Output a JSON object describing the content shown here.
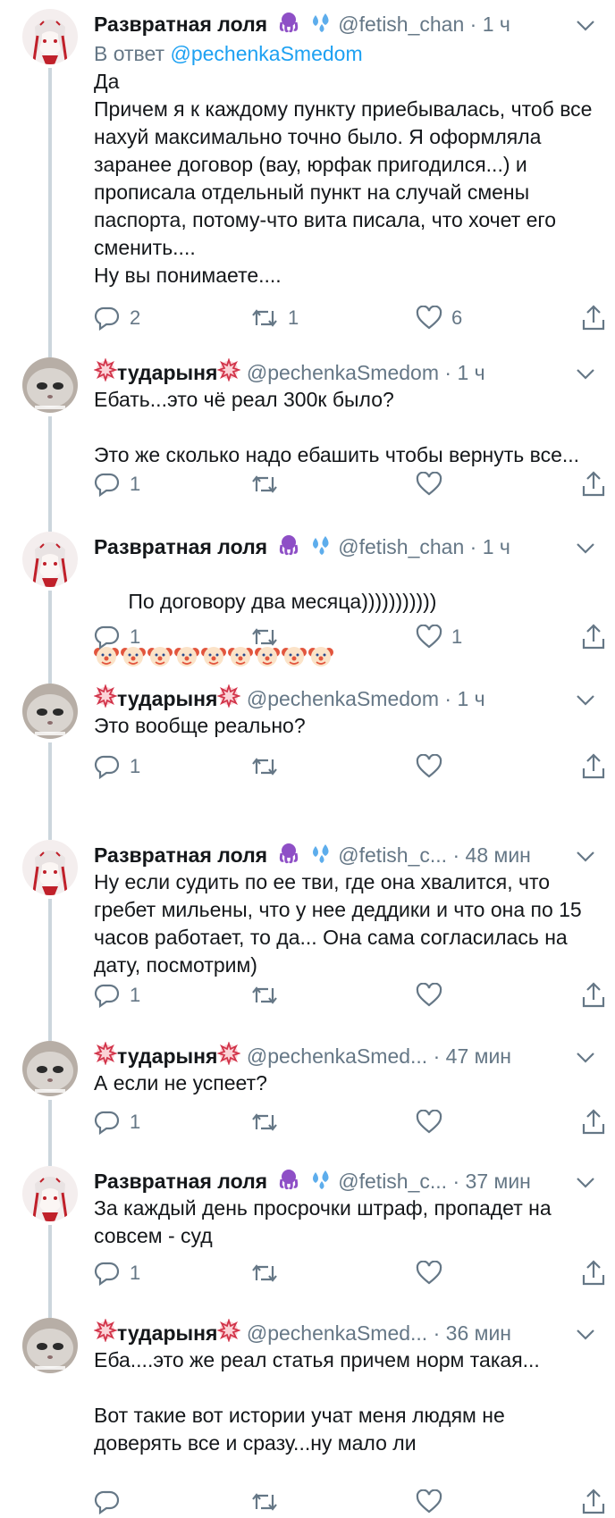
{
  "colors": {
    "text": "#14171a",
    "secondary": "#657786",
    "link": "#1da1f2",
    "thread_line": "#ccd6dd",
    "divider": "#e6ecf0"
  },
  "users": {
    "lola": {
      "display_name": "Развратная лоля",
      "emoji": [
        "octopus",
        "sweat-droplets"
      ]
    },
    "tudarynya": {
      "display_name": "тударыня",
      "emoji": [
        "wilted-flower-badge",
        "wilted-flower-badge"
      ]
    }
  },
  "tweets": [
    {
      "author": "Развратная лоля",
      "handle": "@fetish_chan",
      "dot": "·",
      "time": "1 ч",
      "reply_prefix": "В ответ ",
      "reply_mention": "@pechenkaSmedom",
      "text": "Да\nПричем я к каждому пункту приебывалась, чтоб все нахуй максимально точно было. Я оформляла заранее договор (вау, юрфак пригодился...) и прописала отдельный пункт на случай смены паспорта, потому-что вита писала, что хочет его сменить....\nНу вы понимаете....",
      "replies": "2",
      "retweets": "1",
      "likes": "6"
    },
    {
      "author": "тударыня",
      "handle": "@pechenkaSmedom",
      "dot": "·",
      "time": "1 ч",
      "text": "Ебать...это чё реал 300к было?\n\nЭто же сколько надо ебашить чтобы вернуть все...",
      "replies": "1",
      "retweets": "",
      "likes": ""
    },
    {
      "author": "Развратная лоля",
      "handle": "@fetish_chan",
      "dot": "·",
      "time": "1 ч",
      "text": "По договору два месяца)))))))))))",
      "emoji_row": "clown-face x9",
      "replies": "1",
      "retweets": "",
      "likes": "1"
    },
    {
      "author": "тударыня",
      "handle": "@pechenkaSmedom",
      "dot": "·",
      "time": "1 ч",
      "text": "Это вообще реально?",
      "replies": "1",
      "retweets": "",
      "likes": ""
    },
    {
      "author": "Развратная лоля",
      "handle": "@fetish_c...",
      "dot": "·",
      "time": "48 мин",
      "text": "Ну если судить по ее тви, где она хвалится, что гребет мильены, что у нее деддики и что она по 15 часов работает, то да... Она сама согласилась на дату, посмотрим)",
      "replies": "1",
      "retweets": "",
      "likes": ""
    },
    {
      "author": "тударыня",
      "handle": "@pechenkaSmed...",
      "dot": "·",
      "time": "47 мин",
      "text": "А если не успеет?",
      "replies": "1",
      "retweets": "",
      "likes": ""
    },
    {
      "author": "Развратная лоля",
      "handle": "@fetish_c...",
      "dot": "·",
      "time": "37 мин",
      "text": "За каждый день просрочки штраф, пропадет на совсем - суд",
      "replies": "1",
      "retweets": "",
      "likes": ""
    },
    {
      "author": "тударыня",
      "handle": "@pechenkaSmed...",
      "dot": "·",
      "time": "36 мин",
      "text": "Еба....это же реал статья причем норм такая...\n\nВот такие вот истории учат меня людям не доверять все и сразу...ну мало ли",
      "replies": "",
      "retweets": "",
      "likes": ""
    }
  ]
}
